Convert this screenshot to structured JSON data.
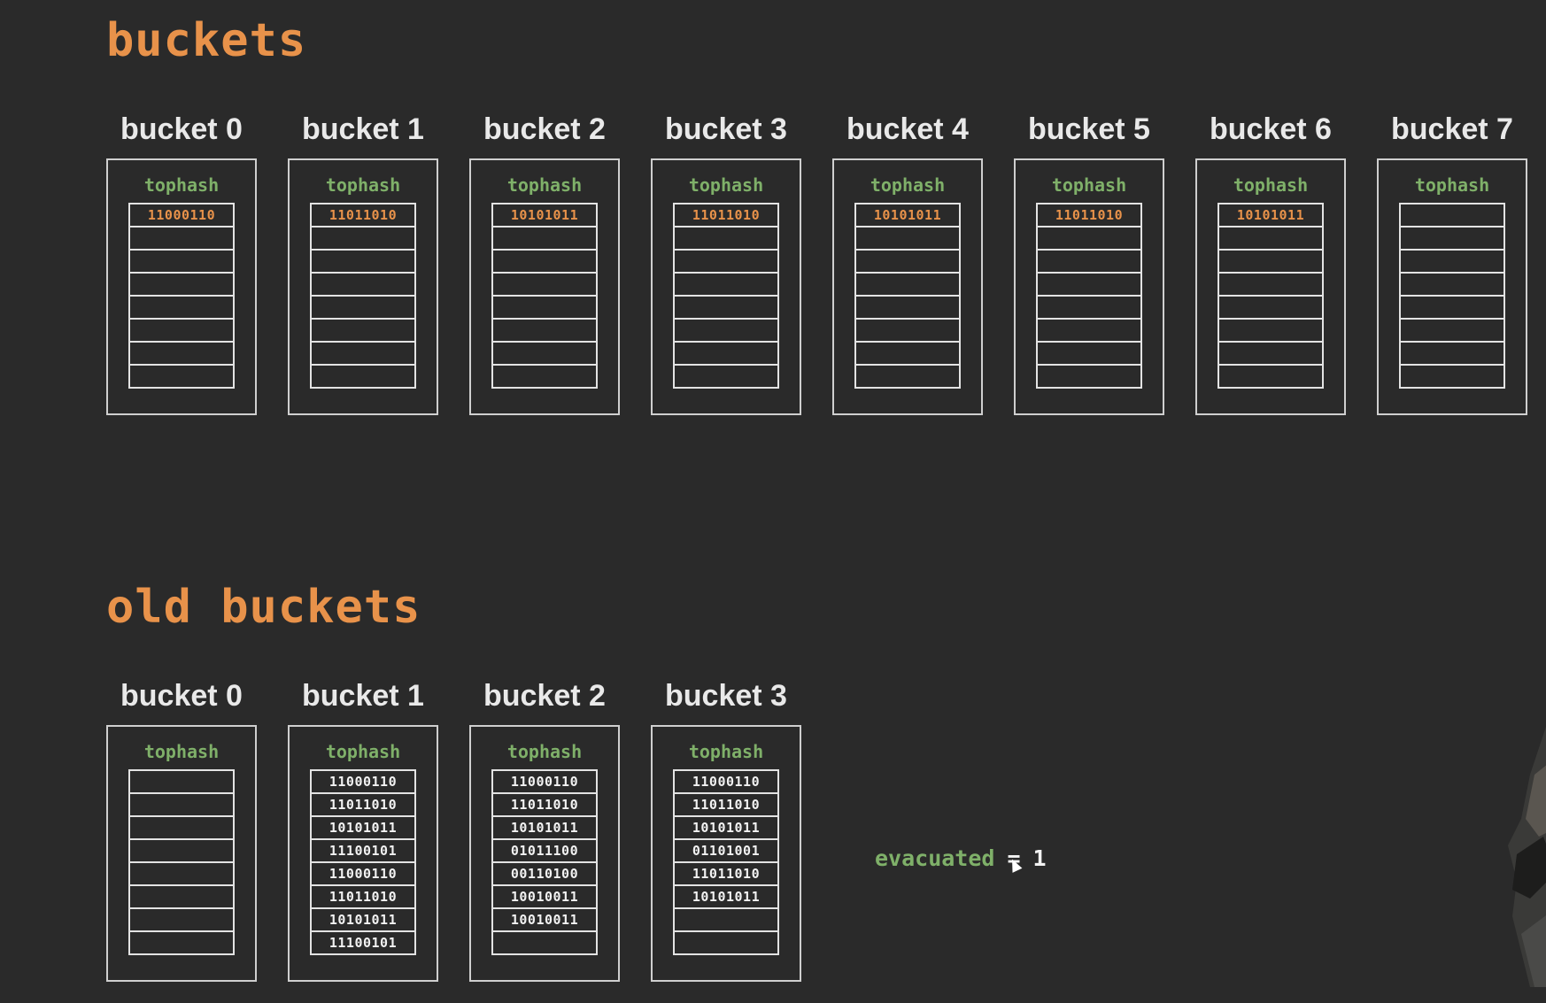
{
  "sections": {
    "buckets_title": "buckets",
    "old_buckets_title": "old buckets"
  },
  "buckets": [
    {
      "label": "bucket 0",
      "tophash_label": "tophash",
      "slots": [
        "11000110",
        "",
        "",
        "",
        "",
        "",
        "",
        ""
      ]
    },
    {
      "label": "bucket 1",
      "tophash_label": "tophash",
      "slots": [
        "11011010",
        "",
        "",
        "",
        "",
        "",
        "",
        ""
      ]
    },
    {
      "label": "bucket 2",
      "tophash_label": "tophash",
      "slots": [
        "10101011",
        "",
        "",
        "",
        "",
        "",
        "",
        ""
      ]
    },
    {
      "label": "bucket 3",
      "tophash_label": "tophash",
      "slots": [
        "11011010",
        "",
        "",
        "",
        "",
        "",
        "",
        ""
      ]
    },
    {
      "label": "bucket 4",
      "tophash_label": "tophash",
      "slots": [
        "10101011",
        "",
        "",
        "",
        "",
        "",
        "",
        ""
      ]
    },
    {
      "label": "bucket 5",
      "tophash_label": "tophash",
      "slots": [
        "11011010",
        "",
        "",
        "",
        "",
        "",
        "",
        ""
      ]
    },
    {
      "label": "bucket 6",
      "tophash_label": "tophash",
      "slots": [
        "10101011",
        "",
        "",
        "",
        "",
        "",
        "",
        ""
      ]
    },
    {
      "label": "bucket 7",
      "tophash_label": "tophash",
      "slots": [
        "",
        "",
        "",
        "",
        "",
        "",
        "",
        ""
      ]
    }
  ],
  "old_buckets": [
    {
      "label": "bucket 0",
      "tophash_label": "tophash",
      "slots": [
        "",
        "",
        "",
        "",
        "",
        "",
        "",
        ""
      ]
    },
    {
      "label": "bucket 1",
      "tophash_label": "tophash",
      "slots": [
        "11000110",
        "11011010",
        "10101011",
        "11100101",
        "11000110",
        "11011010",
        "10101011",
        "11100101"
      ]
    },
    {
      "label": "bucket 2",
      "tophash_label": "tophash",
      "slots": [
        "11000110",
        "11011010",
        "10101011",
        "01011100",
        "00110100",
        "10010011",
        "10010011",
        ""
      ]
    },
    {
      "label": "bucket 3",
      "tophash_label": "tophash",
      "slots": [
        "11000110",
        "11011010",
        "10101011",
        "01101001",
        "11011010",
        "10101011",
        "",
        ""
      ]
    }
  ],
  "evacuated": {
    "name": "evacuated",
    "operator": "=",
    "value": "1"
  },
  "colors": {
    "background": "#2a2a2a",
    "title": "#e8924a",
    "tophash": "#7fb069",
    "new_hash": "#e8924a",
    "text": "#f2f2f2"
  },
  "icons": {
    "cursor": "mouse-pointer-icon"
  }
}
